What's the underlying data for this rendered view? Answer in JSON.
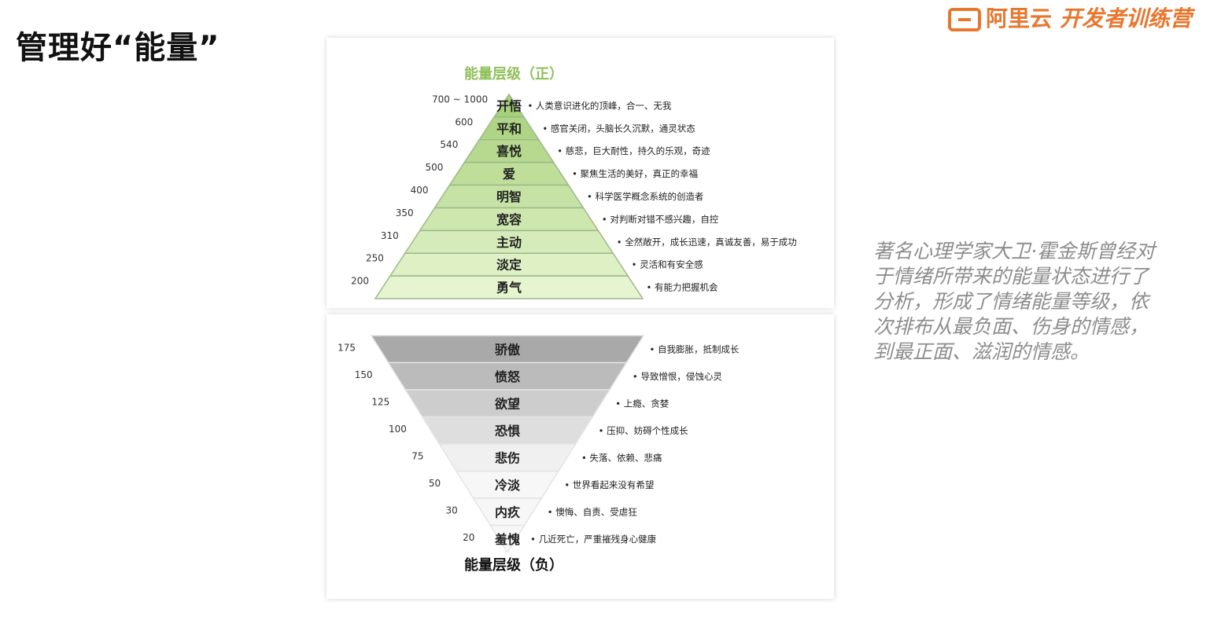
{
  "slide": {
    "title": "管理好“能量”",
    "logo": {
      "brand": "阿里云",
      "program": "开发者训练营"
    },
    "description": "著名心理学家大卫·霍金斯曾经对于情绪所带来的能量状态进行了分析，形成了情绪能量等级，依次排布从最负面、伤身的情感，到最正面、滋润的情感。"
  },
  "positive": {
    "title": "能量层级（正）",
    "title_color": "#8fbf5a",
    "fill_top": "#a6d07a",
    "fill_bottom": "#e6f4cf",
    "levels": [
      {
        "value": "700 ~ 1000",
        "name": "开悟",
        "desc": "人类意识进化的顶峰，合一、无我"
      },
      {
        "value": "600",
        "name": "平和",
        "desc": "感官关闭，头脑长久沉默，通灵状态"
      },
      {
        "value": "540",
        "name": "喜悦",
        "desc": "慈悲，巨大耐性，持久的乐观，奇迹"
      },
      {
        "value": "500",
        "name": "爱",
        "desc": "聚焦生活的美好，真正的幸福"
      },
      {
        "value": "400",
        "name": "明智",
        "desc": "科学医学概念系统的创造者"
      },
      {
        "value": "350",
        "name": "宽容",
        "desc": "对判断对错不感兴趣，自控"
      },
      {
        "value": "310",
        "name": "主动",
        "desc": "全然敞开，成长迅速，真诚友善，易于成功"
      },
      {
        "value": "250",
        "name": "淡定",
        "desc": "灵活和有安全感"
      },
      {
        "value": "200",
        "name": "勇气",
        "desc": "有能力把握机会"
      }
    ]
  },
  "negative": {
    "title": "能量层级（负）",
    "fill_top": "#a9a9a9",
    "fill_bottom": "#f7f7f7",
    "levels": [
      {
        "value": "175",
        "name": "骄傲",
        "desc": "自我膨胀，抵制成长"
      },
      {
        "value": "150",
        "name": "愤怒",
        "desc": "导致憎恨，侵蚀心灵"
      },
      {
        "value": "125",
        "name": "欲望",
        "desc": "上瘾、贪婪"
      },
      {
        "value": "100",
        "name": "恐惧",
        "desc": "压抑、妨碍个性成长"
      },
      {
        "value": "75",
        "name": "悲伤",
        "desc": "失落、依赖、悲痛"
      },
      {
        "value": "50",
        "name": "冷淡",
        "desc": "世界看起来没有希望"
      },
      {
        "value": "30",
        "name": "内疚",
        "desc": "懊悔、自责、受虐狂"
      },
      {
        "value": "20",
        "name": "羞愧",
        "desc": "几近死亡，严重摧残身心健康"
      }
    ]
  }
}
